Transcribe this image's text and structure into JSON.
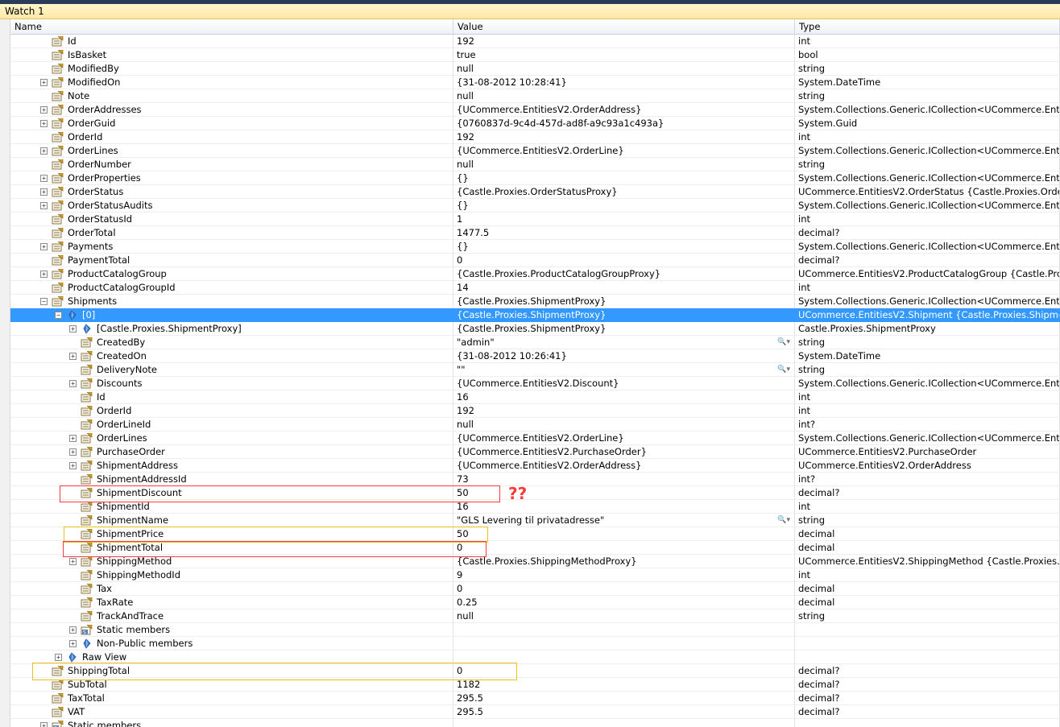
{
  "window": {
    "title": "Watch 1"
  },
  "columns": {
    "name": "Name",
    "value": "Value",
    "type": "Type"
  },
  "colors": {
    "selected_row": "#3399ff",
    "annotation_red": "#ff3a3a",
    "annotation_yellow": "#e8c21a"
  },
  "annotation": {
    "question": "??"
  },
  "rows": [
    {
      "name": "Id",
      "value": "192",
      "type": "int",
      "depth": 0,
      "expander": "none",
      "icon": "property-icon"
    },
    {
      "name": "IsBasket",
      "value": "true",
      "type": "bool",
      "depth": 0,
      "expander": "none",
      "icon": "property-icon"
    },
    {
      "name": "ModifiedBy",
      "value": "null",
      "type": "string",
      "depth": 0,
      "expander": "none",
      "icon": "property-icon"
    },
    {
      "name": "ModifiedOn",
      "value": "{31-08-2012 10:28:41}",
      "type": "System.DateTime",
      "depth": 0,
      "expander": "plus",
      "icon": "property-icon"
    },
    {
      "name": "Note",
      "value": "null",
      "type": "string",
      "depth": 0,
      "expander": "none",
      "icon": "property-icon"
    },
    {
      "name": "OrderAddresses",
      "value": "{UCommerce.EntitiesV2.OrderAddress}",
      "type": "System.Collections.Generic.ICollection<UCommerce.EntitiesV2.OrderAddress>",
      "depth": 0,
      "expander": "plus",
      "icon": "property-icon"
    },
    {
      "name": "OrderGuid",
      "value": "{0760837d-9c4d-457d-ad8f-a9c93a1c493a}",
      "type": "System.Guid",
      "depth": 0,
      "expander": "plus",
      "icon": "property-icon"
    },
    {
      "name": "OrderId",
      "value": "192",
      "type": "int",
      "depth": 0,
      "expander": "none",
      "icon": "property-icon"
    },
    {
      "name": "OrderLines",
      "value": "{UCommerce.EntitiesV2.OrderLine}",
      "type": "System.Collections.Generic.ICollection<UCommerce.EntitiesV2.OrderLine>",
      "depth": 0,
      "expander": "plus",
      "icon": "property-icon"
    },
    {
      "name": "OrderNumber",
      "value": "null",
      "type": "string",
      "depth": 0,
      "expander": "none",
      "icon": "property-icon"
    },
    {
      "name": "OrderProperties",
      "value": "{}",
      "type": "System.Collections.Generic.ICollection<UCommerce.EntitiesV2.OrderProperty>",
      "depth": 0,
      "expander": "plus",
      "icon": "property-icon"
    },
    {
      "name": "OrderStatus",
      "value": "{Castle.Proxies.OrderStatusProxy}",
      "type": "UCommerce.EntitiesV2.OrderStatus {Castle.Proxies.OrderStatusProxy}",
      "depth": 0,
      "expander": "plus",
      "icon": "property-icon"
    },
    {
      "name": "OrderStatusAudits",
      "value": "{}",
      "type": "System.Collections.Generic.ICollection<UCommerce.EntitiesV2.OrderStatusAudit>",
      "depth": 0,
      "expander": "plus",
      "icon": "property-icon"
    },
    {
      "name": "OrderStatusId",
      "value": "1",
      "type": "int",
      "depth": 0,
      "expander": "none",
      "icon": "property-icon"
    },
    {
      "name": "OrderTotal",
      "value": "1477.5",
      "type": "decimal?",
      "depth": 0,
      "expander": "none",
      "icon": "property-icon"
    },
    {
      "name": "Payments",
      "value": "{}",
      "type": "System.Collections.Generic.ICollection<UCommerce.EntitiesV2.Payment>",
      "depth": 0,
      "expander": "plus",
      "icon": "property-icon"
    },
    {
      "name": "PaymentTotal",
      "value": "0",
      "type": "decimal?",
      "depth": 0,
      "expander": "none",
      "icon": "property-icon"
    },
    {
      "name": "ProductCatalogGroup",
      "value": "{Castle.Proxies.ProductCatalogGroupProxy}",
      "type": "UCommerce.EntitiesV2.ProductCatalogGroup {Castle.Proxies.ProductCatalogGroupProxy}",
      "depth": 0,
      "expander": "plus",
      "icon": "property-icon"
    },
    {
      "name": "ProductCatalogGroupId",
      "value": "14",
      "type": "int",
      "depth": 0,
      "expander": "none",
      "icon": "property-icon"
    },
    {
      "name": "Shipments",
      "value": "{Castle.Proxies.ShipmentProxy}",
      "type": "System.Collections.Generic.ICollection<UCommerce.EntitiesV2.Shipment>",
      "depth": 0,
      "expander": "minus",
      "icon": "property-icon"
    },
    {
      "name": "[0]",
      "value": "{Castle.Proxies.ShipmentProxy}",
      "type": "UCommerce.EntitiesV2.Shipment {Castle.Proxies.ShipmentProxy}",
      "depth": 1,
      "expander": "minus",
      "icon": "field-icon",
      "selected": true
    },
    {
      "name": "[Castle.Proxies.ShipmentProxy]",
      "value": "{Castle.Proxies.ShipmentProxy}",
      "type": "Castle.Proxies.ShipmentProxy",
      "depth": 2,
      "expander": "plus",
      "icon": "field-icon"
    },
    {
      "name": "CreatedBy",
      "value": "\"admin\"",
      "type": "string",
      "depth": 2,
      "expander": "none",
      "icon": "property-icon",
      "viewer": true
    },
    {
      "name": "CreatedOn",
      "value": "{31-08-2012 10:26:41}",
      "type": "System.DateTime",
      "depth": 2,
      "expander": "plus",
      "icon": "property-icon"
    },
    {
      "name": "DeliveryNote",
      "value": "\"\"",
      "type": "string",
      "depth": 2,
      "expander": "none",
      "icon": "property-icon",
      "viewer": true
    },
    {
      "name": "Discounts",
      "value": "{UCommerce.EntitiesV2.Discount}",
      "type": "System.Collections.Generic.ICollection<UCommerce.EntitiesV2.Discount>",
      "depth": 2,
      "expander": "plus",
      "icon": "property-icon"
    },
    {
      "name": "Id",
      "value": "16",
      "type": "int",
      "depth": 2,
      "expander": "none",
      "icon": "property-icon"
    },
    {
      "name": "OrderId",
      "value": "192",
      "type": "int",
      "depth": 2,
      "expander": "none",
      "icon": "property-icon"
    },
    {
      "name": "OrderLineId",
      "value": "null",
      "type": "int?",
      "depth": 2,
      "expander": "none",
      "icon": "property-icon"
    },
    {
      "name": "OrderLines",
      "value": "{UCommerce.EntitiesV2.OrderLine}",
      "type": "System.Collections.Generic.ICollection<UCommerce.EntitiesV2.OrderLine>",
      "depth": 2,
      "expander": "plus",
      "icon": "property-icon"
    },
    {
      "name": "PurchaseOrder",
      "value": "{UCommerce.EntitiesV2.PurchaseOrder}",
      "type": "UCommerce.EntitiesV2.PurchaseOrder",
      "depth": 2,
      "expander": "plus",
      "icon": "property-icon"
    },
    {
      "name": "ShipmentAddress",
      "value": "{UCommerce.EntitiesV2.OrderAddress}",
      "type": "UCommerce.EntitiesV2.OrderAddress",
      "depth": 2,
      "expander": "plus",
      "icon": "property-icon"
    },
    {
      "name": "ShipmentAddressId",
      "value": "73",
      "type": "int?",
      "depth": 2,
      "expander": "none",
      "icon": "property-icon"
    },
    {
      "name": "ShipmentDiscount",
      "value": "50",
      "type": "decimal?",
      "depth": 2,
      "expander": "none",
      "icon": "property-icon"
    },
    {
      "name": "ShipmentId",
      "value": "16",
      "type": "int",
      "depth": 2,
      "expander": "none",
      "icon": "property-icon"
    },
    {
      "name": "ShipmentName",
      "value": "\"GLS Levering til privatadresse\"",
      "type": "string",
      "depth": 2,
      "expander": "none",
      "icon": "property-icon",
      "viewer": true
    },
    {
      "name": "ShipmentPrice",
      "value": "50",
      "type": "decimal",
      "depth": 2,
      "expander": "none",
      "icon": "property-icon"
    },
    {
      "name": "ShipmentTotal",
      "value": "0",
      "type": "decimal",
      "depth": 2,
      "expander": "none",
      "icon": "property-icon"
    },
    {
      "name": "ShippingMethod",
      "value": "{Castle.Proxies.ShippingMethodProxy}",
      "type": "UCommerce.EntitiesV2.ShippingMethod {Castle.Proxies.ShippingMethodProxy}",
      "depth": 2,
      "expander": "plus",
      "icon": "property-icon"
    },
    {
      "name": "ShippingMethodId",
      "value": "9",
      "type": "int",
      "depth": 2,
      "expander": "none",
      "icon": "property-icon"
    },
    {
      "name": "Tax",
      "value": "0",
      "type": "decimal",
      "depth": 2,
      "expander": "none",
      "icon": "property-icon"
    },
    {
      "name": "TaxRate",
      "value": "0.25",
      "type": "decimal",
      "depth": 2,
      "expander": "none",
      "icon": "property-icon"
    },
    {
      "name": "TrackAndTrace",
      "value": "null",
      "type": "string",
      "depth": 2,
      "expander": "none",
      "icon": "property-icon"
    },
    {
      "name": "Static members",
      "value": "",
      "type": "",
      "depth": 2,
      "expander": "plus",
      "icon": "static-members-icon"
    },
    {
      "name": "Non-Public members",
      "value": "",
      "type": "",
      "depth": 2,
      "expander": "plus",
      "icon": "field-icon"
    },
    {
      "name": "Raw View",
      "value": "",
      "type": "",
      "depth": 1,
      "expander": "plus",
      "icon": "field-icon"
    },
    {
      "name": "ShippingTotal",
      "value": "0",
      "type": "decimal?",
      "depth": 0,
      "expander": "none",
      "icon": "property-icon"
    },
    {
      "name": "SubTotal",
      "value": "1182",
      "type": "decimal?",
      "depth": 0,
      "expander": "none",
      "icon": "property-icon"
    },
    {
      "name": "TaxTotal",
      "value": "295.5",
      "type": "decimal?",
      "depth": 0,
      "expander": "none",
      "icon": "property-icon"
    },
    {
      "name": "VAT",
      "value": "295.5",
      "type": "decimal?",
      "depth": 0,
      "expander": "none",
      "icon": "property-icon"
    },
    {
      "name": "Static members",
      "value": "",
      "type": "",
      "depth": 0,
      "expander": "plus",
      "icon": "static-members-icon"
    }
  ]
}
